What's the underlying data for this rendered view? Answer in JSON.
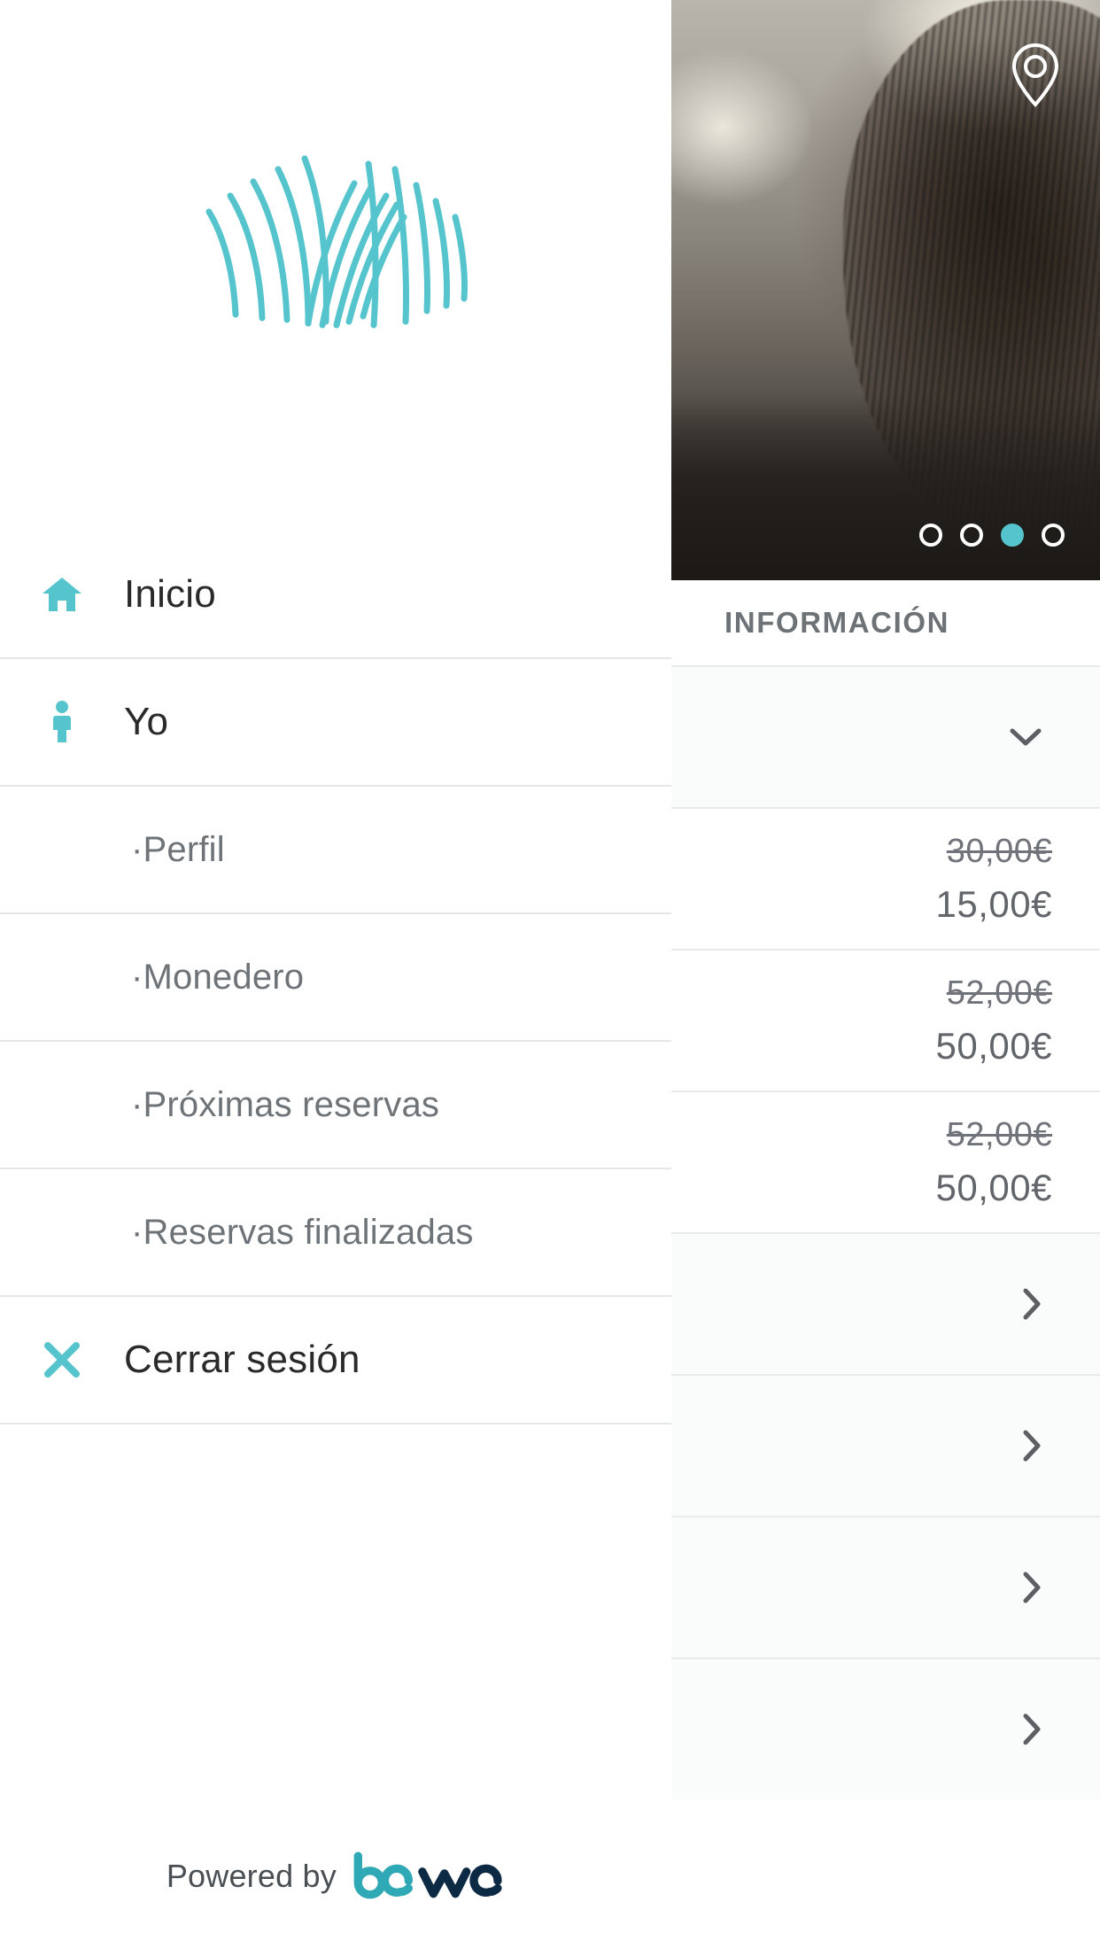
{
  "brand": {
    "accent": "#56c4cd",
    "logo_name": "salon-logo",
    "footer_prefix": "Powered by",
    "footer_brand": "bewe",
    "footer_brand_colors": {
      "be": "#2fa9b5",
      "we": "#0d2a45"
    }
  },
  "drawer": {
    "items": [
      {
        "label": "Inicio",
        "icon": "home-icon",
        "level": "top",
        "name": "inicio"
      },
      {
        "label": "Yo",
        "icon": "person-icon",
        "level": "top",
        "name": "yo"
      },
      {
        "label": "·Perfil",
        "icon": "",
        "level": "sub",
        "name": "perfil"
      },
      {
        "label": "·Monedero",
        "icon": "",
        "level": "sub",
        "name": "monedero"
      },
      {
        "label": "·Próximas reservas",
        "icon": "",
        "level": "sub",
        "name": "proximas-reservas"
      },
      {
        "label": "·Reservas finalizadas",
        "icon": "",
        "level": "sub",
        "name": "reservas-finalizadas"
      },
      {
        "label": "Cerrar sesión",
        "icon": "close-x-icon",
        "level": "top",
        "name": "cerrar-sesion"
      }
    ]
  },
  "content": {
    "hero": {
      "location_icon": "location-pin-icon",
      "carousel": {
        "total": 4,
        "active_index": 2
      }
    },
    "section_title": "INFORMACIÓN",
    "rows": [
      {
        "type": "expander",
        "chevron": "chevron-down-icon",
        "name": "info-expander"
      },
      {
        "type": "price",
        "old": "30,00€",
        "new": "15,00€",
        "name": "price-row-1"
      },
      {
        "type": "price",
        "old": "52,00€",
        "new": "50,00€",
        "name": "price-row-2"
      },
      {
        "type": "price",
        "old": "52,00€",
        "new": "50,00€",
        "name": "price-row-3"
      },
      {
        "type": "link",
        "chevron": "chevron-right-icon",
        "name": "link-row-1"
      },
      {
        "type": "link",
        "chevron": "chevron-right-icon",
        "name": "link-row-2"
      },
      {
        "type": "link",
        "chevron": "chevron-right-icon",
        "name": "link-row-3"
      },
      {
        "type": "link",
        "chevron": "chevron-right-icon",
        "name": "link-row-4"
      }
    ]
  }
}
